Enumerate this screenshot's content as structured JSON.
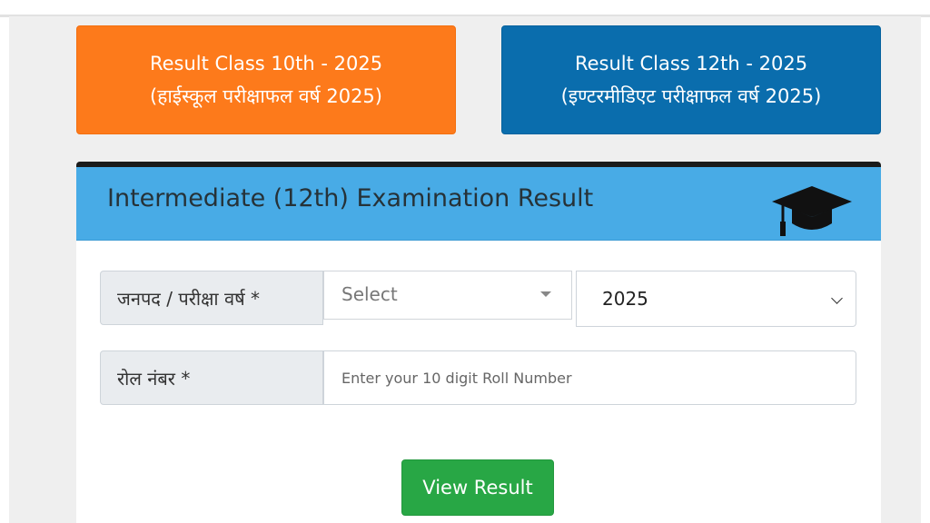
{
  "result_links": {
    "class10": {
      "line1": "Result Class 10th - 2025",
      "line2": "(हाईस्कूल परीक्षाफल वर्ष 2025)"
    },
    "class12": {
      "line1": "Result Class 12th - 2025",
      "line2": "(इण्टरमीडिएट परीक्षाफल वर्ष 2025)"
    }
  },
  "card": {
    "title": "Intermediate (12th) Examination Result",
    "header_icon": "graduation-cap-icon"
  },
  "form": {
    "district_year_label": "जनपद / परीक्षा वर्ष *",
    "district_placeholder": "Select",
    "year_value": "2025",
    "roll_label": "रोल नंबर *",
    "roll_placeholder": "Enter your 10 digit Roll Number",
    "submit_label": "View Result"
  },
  "colors": {
    "class10_button": "#fd7a1b",
    "class12_button": "#0a6dad",
    "card_header": "#48abe6",
    "submit_button": "#28a745"
  }
}
